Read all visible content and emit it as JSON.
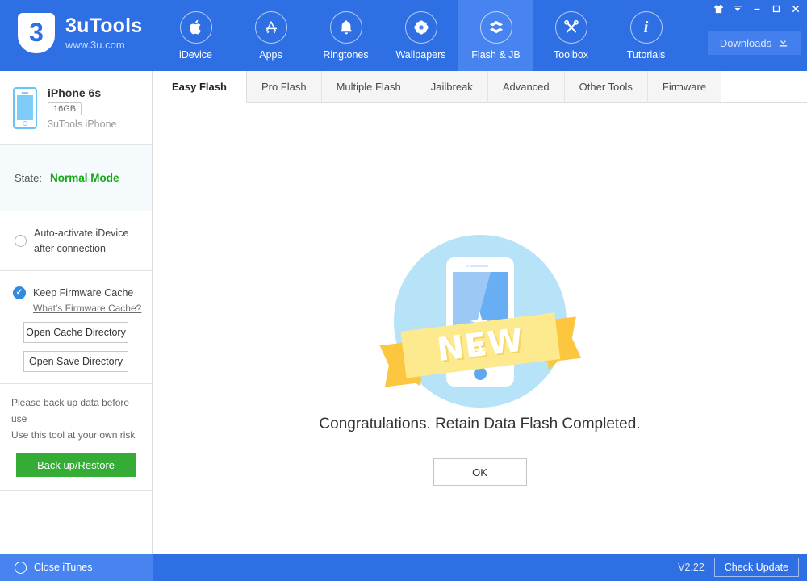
{
  "header": {
    "brand_name": "3uTools",
    "brand_url": "www.3u.com",
    "logo_glyph": "3",
    "nav": [
      {
        "label": "iDevice",
        "icon": "apple-icon",
        "active": false
      },
      {
        "label": "Apps",
        "icon": "app-store-icon",
        "active": false
      },
      {
        "label": "Ringtones",
        "icon": "bell-icon",
        "active": false
      },
      {
        "label": "Wallpapers",
        "icon": "flower-icon",
        "active": false
      },
      {
        "label": "Flash & JB",
        "icon": "open-box-icon",
        "active": true
      },
      {
        "label": "Toolbox",
        "icon": "wrench-screwdriver-icon",
        "active": false
      },
      {
        "label": "Tutorials",
        "icon": "info-icon",
        "active": false
      }
    ],
    "downloads_label": "Downloads",
    "window_controls": [
      {
        "name": "skin-icon"
      },
      {
        "name": "dropdown-icon"
      },
      {
        "name": "minimize-icon"
      },
      {
        "name": "maximize-icon"
      },
      {
        "name": "close-icon"
      }
    ]
  },
  "sidebar": {
    "device": {
      "name": "iPhone 6s",
      "capacity": "16GB",
      "alias": "3uTools iPhone"
    },
    "state": {
      "label": "State:",
      "value": "Normal Mode",
      "value_color": "#14a814"
    },
    "auto_activate": {
      "label": "Auto-activate iDevice after connection",
      "checked": false
    },
    "cache": {
      "label": "Keep Firmware Cache",
      "checked": true,
      "link": "What's Firmware Cache?",
      "open_cache_label": "Open Cache Directory",
      "open_save_label": "Open Save Directory"
    },
    "backup": {
      "note_line1": "Please back up data before use",
      "note_line2": "Use this tool at your own risk",
      "button_label": "Back up/Restore",
      "button_color": "#35ac35"
    }
  },
  "main": {
    "tabs": [
      {
        "label": "Easy Flash",
        "active": true
      },
      {
        "label": "Pro Flash",
        "active": false
      },
      {
        "label": "Multiple Flash",
        "active": false
      },
      {
        "label": "Jailbreak",
        "active": false
      },
      {
        "label": "Advanced",
        "active": false
      },
      {
        "label": "Other Tools",
        "active": false
      },
      {
        "label": "Firmware",
        "active": false
      }
    ],
    "illustration": {
      "ribbon_text": "NEW",
      "circle_color": "#b6e3f8",
      "ribbon_color": "#fde98e",
      "ribbon_tail_color": "#fdc63f"
    },
    "message": "Congratulations. Retain Data Flash Completed.",
    "ok_label": "OK"
  },
  "statusbar": {
    "close_itunes_label": "Close iTunes",
    "close_itunes_checked": false,
    "version": "V2.22",
    "check_update_label": "Check Update"
  }
}
